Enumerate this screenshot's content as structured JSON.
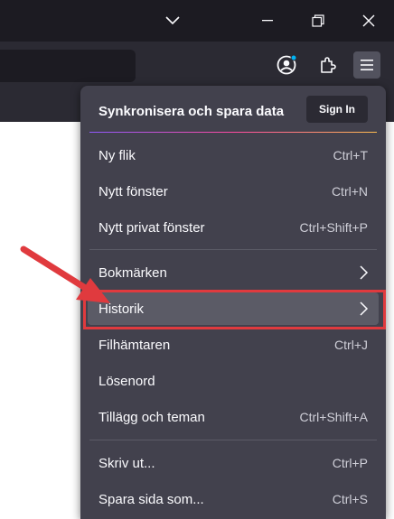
{
  "window": {
    "controls": [
      "chevron-down-icon",
      "minimize-icon",
      "restore-icon",
      "close-icon"
    ]
  },
  "toolbar": {
    "icons": [
      "account-icon",
      "extensions-icon",
      "hamburger-menu-icon"
    ]
  },
  "menu": {
    "sync_title": "Synkronisera och spara data",
    "sign_in": "Sign In",
    "items": [
      {
        "label": "Ny flik",
        "shortcut": "Ctrl+T"
      },
      {
        "label": "Nytt fönster",
        "shortcut": "Ctrl+N"
      },
      {
        "label": "Nytt privat fönster",
        "shortcut": "Ctrl+Shift+P"
      },
      {
        "label": "Bokmärken",
        "shortcut": ""
      },
      {
        "label": "Historik",
        "shortcut": ""
      },
      {
        "label": "Filhämtaren",
        "shortcut": "Ctrl+J"
      },
      {
        "label": "Lösenord",
        "shortcut": ""
      },
      {
        "label": "Tillägg och teman",
        "shortcut": "Ctrl+Shift+A"
      },
      {
        "label": "Skriv ut...",
        "shortcut": "Ctrl+P"
      },
      {
        "label": "Spara sida som...",
        "shortcut": "Ctrl+S"
      }
    ],
    "highlighted_item": "Historik"
  },
  "colors": {
    "titlebar": "#1c1b22",
    "navbar": "#2b2a33",
    "panel": "#42414d",
    "hover": "#5b5b66",
    "annotation": "#e03a3e"
  }
}
